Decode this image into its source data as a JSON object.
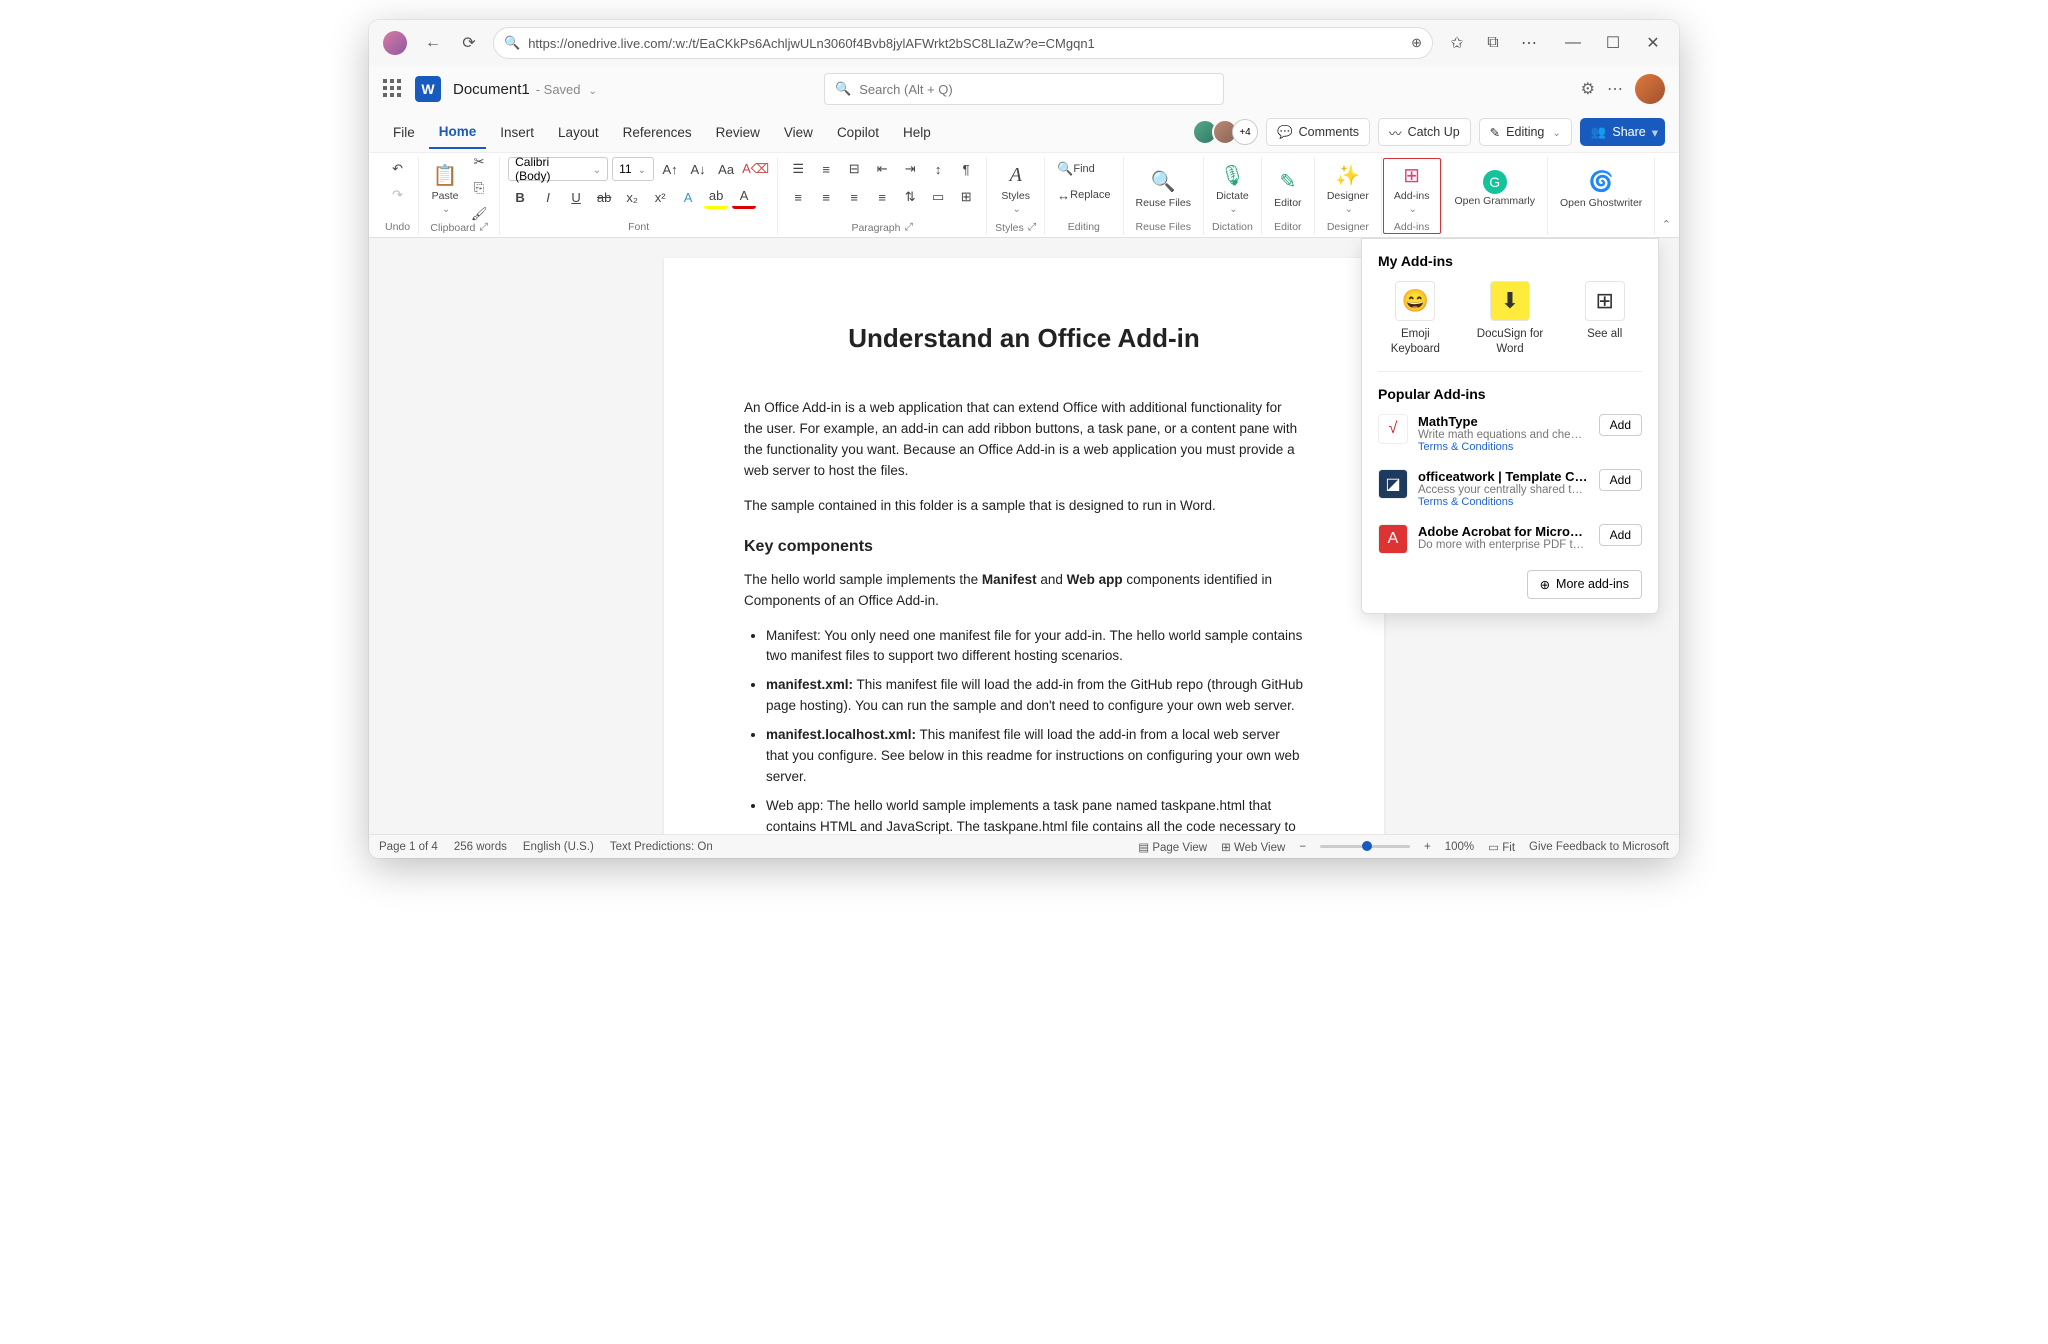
{
  "browser": {
    "url": "https://onedrive.live.com/:w:/t/EaCKkPs6AchljwULn3060f4Bvb8jylAFWrkt2bSC8LIaZw?e=CMgqn1"
  },
  "header": {
    "doc_name": "Document1",
    "saved": "- Saved",
    "search_placeholder": "Search (Alt + Q)"
  },
  "tabs": [
    "File",
    "Home",
    "Insert",
    "Layout",
    "References",
    "Review",
    "View",
    "Copilot",
    "Help"
  ],
  "tabs_active": "Home",
  "tabbar": {
    "presence_extra": "+4",
    "comments": "Comments",
    "catchup": "Catch Up",
    "editing": "Editing",
    "share": "Share"
  },
  "ribbon": {
    "undo": "Undo",
    "clipboard": "Clipboard",
    "paste": "Paste",
    "font": "Font",
    "font_name": "Calibri (Body)",
    "font_size": "11",
    "paragraph": "Paragraph",
    "styles": "Styles",
    "styles_btn": "Styles",
    "editing": "Editing",
    "find": "Find",
    "replace": "Replace",
    "reuse_files": "Reuse Files",
    "reuse_files_btn": "Reuse Files",
    "dictation": "Dictation",
    "dictate": "Dictate",
    "editor": "Editor",
    "editor_btn": "Editor",
    "designer": "Designer",
    "designer_btn": "Designer",
    "addins": "Add-ins",
    "addins_btn": "Add-ins",
    "grammarly": "Open Grammarly",
    "ghostwriter": "Open Ghostwriter"
  },
  "document": {
    "title": "Understand an Office Add-in",
    "p1": "An Office Add-in is a web application that can extend Office with additional functionality for the user. For example, an add-in can add ribbon buttons, a task pane, or a content pane with the functionality you want. Because an Office Add-in is a web application you must provide a web server to host the files.",
    "p2": "The sample contained in this folder is a sample that is designed to run in Word.",
    "h2": "Key components",
    "p3a": "The hello world sample implements the ",
    "p3b": "Manifest",
    "p3c": " and ",
    "p3d": "Web app",
    "p3e": " components identified in Components of an Office Add-in.",
    "li1": "Manifest: You only need one manifest file for your add-in. The hello world sample contains two manifest files to support two different hosting scenarios.",
    "li2a": "manifest.xml:",
    "li2b": " This manifest file will load the add-in from the GitHub repo (through GitHub page hosting). You can run the sample and don't need to configure your own web server.",
    "li3a": "manifest.localhost.xml:",
    "li3b": " This manifest file will load the add-in from a local web server that you configure. See below in this readme for instructions on configuring your own web server.",
    "li4": "Web app: The hello world sample implements a task pane named taskpane.html that contains HTML and JavaScript. The taskpane.html file contains all the code necessary to display a task pane, interact with the user, and write \"Hello World\" into the first Paragraph of the document."
  },
  "panel": {
    "my_title": "My Add-ins",
    "tile1": "Emoji Keyboard",
    "tile2": "DocuSign for Word",
    "tile3": "See all",
    "pop_title": "Popular Add-ins",
    "terms": "Terms & Conditions",
    "add": "Add",
    "more": "More add-ins",
    "items": [
      {
        "name": "MathType",
        "desc": "Write math equations and chemical f…"
      },
      {
        "name": "officeatwork | Template Choose…",
        "desc": "Access your centrally shared templats…"
      },
      {
        "name": "Adobe Acrobat for Microsoft W…",
        "desc": "Do more with enterprise PDF tools, b…"
      }
    ]
  },
  "status": {
    "page": "Page 1 of 4",
    "words": "256 words",
    "lang": "English (U.S.)",
    "pred": "Text Predictions: On",
    "pageview": "Page View",
    "webview": "Web View",
    "zoom": "100%",
    "fit": "Fit",
    "feedback": "Give Feedback to Microsoft"
  }
}
